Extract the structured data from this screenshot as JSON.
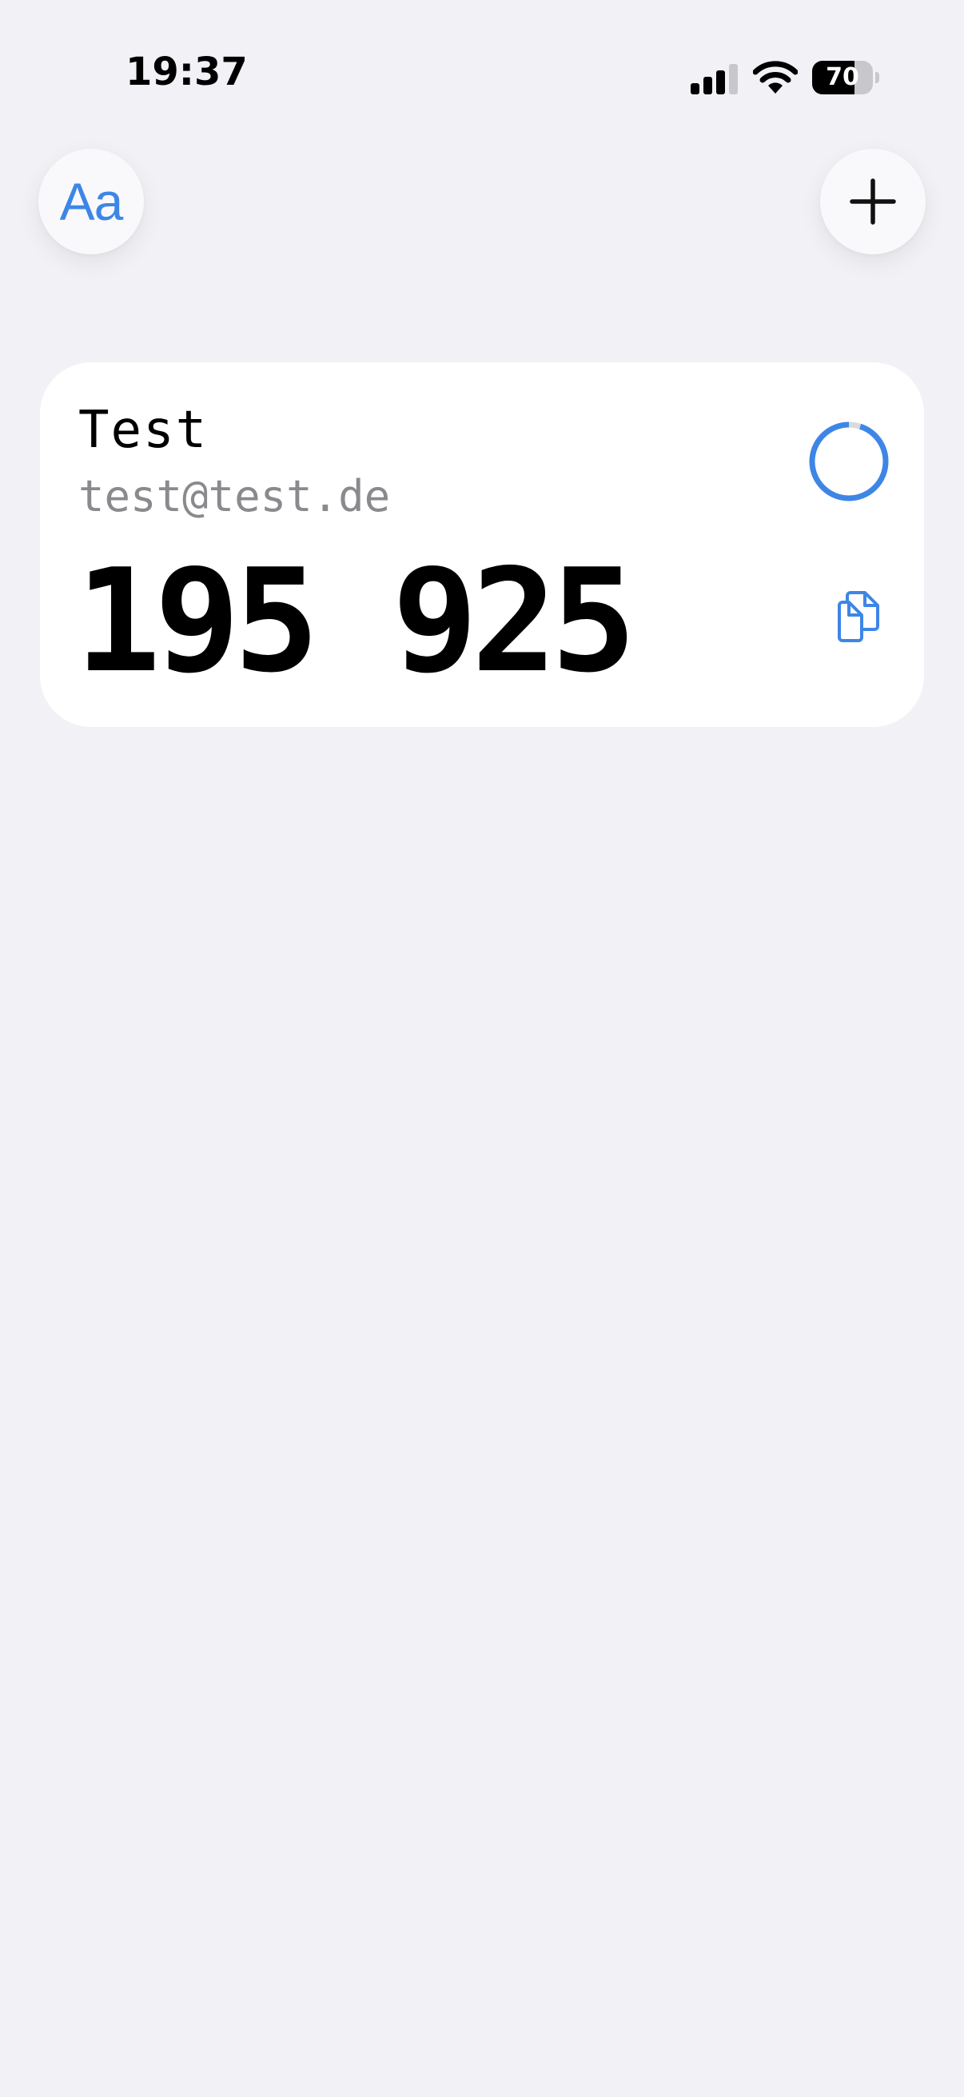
{
  "status_bar": {
    "time": "19:37",
    "battery_level": "70",
    "signal_icon": "signal-bars-icon",
    "wifi_icon": "wifi-icon"
  },
  "toolbar": {
    "font_button_label": "Aa",
    "add_button_icon": "plus-icon"
  },
  "accounts": [
    {
      "name": "Test",
      "email": "test@test.de",
      "code": "195 925",
      "timer_remaining_fraction": 0.95,
      "copy_icon": "copy-icon"
    }
  ],
  "colors": {
    "accent": "#3d86e6",
    "background": "#f1f1f6",
    "card": "#ffffff",
    "secondary_text": "#8a8a8e",
    "ring_track": "#d9d9de"
  }
}
